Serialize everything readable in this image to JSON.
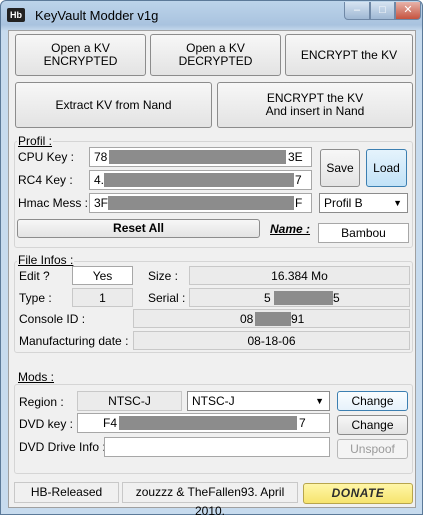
{
  "window": {
    "icon_text": "Hb",
    "title": "KeyVault Modder v1g",
    "min": "–",
    "max": "□",
    "close": "✕"
  },
  "actions": {
    "open_encrypted": "Open a KV\nENCRYPTED",
    "open_decrypted": "Open a KV\nDECRYPTED",
    "encrypt": "ENCRYPT the KV",
    "extract": "Extract KV from Nand",
    "encrypt_insert": "ENCRYPT the KV\nAnd insert in Nand"
  },
  "profil": {
    "legend": "Profil :",
    "cpu_label": "CPU Key :",
    "cpu_start": "78",
    "cpu_end": "3E",
    "rc4_label": "RC4 Key :",
    "rc4_start": "4.",
    "rc4_end": "7",
    "hmac_label": "Hmac Mess :",
    "hmac_start": "3F",
    "hmac_end": "F",
    "save": "Save",
    "load": "Load",
    "profile_select": "Profil B",
    "reset_all": "Reset All",
    "name_label": "Name :",
    "name_value": "Bambou"
  },
  "fileinfo": {
    "legend": "File Infos :",
    "edit_label": "Edit ?",
    "edit_value": "Yes",
    "size_label": "Size :",
    "size_value": "16.384 Mo",
    "type_label": "Type :",
    "type_value": "1",
    "serial_label": "Serial :",
    "serial_start": "5",
    "serial_end": "5",
    "console_label": "Console ID :",
    "console_start": "08",
    "console_end": "91",
    "mfg_label": "Manufacturing date :",
    "mfg_value": "08-18-06"
  },
  "mods": {
    "legend": "Mods :",
    "region_label": "Region :",
    "region_value": "NTSC-J",
    "region_select": "NTSC-J",
    "change1": "Change",
    "dvd_label": "DVD key :",
    "dvd_start": "F4",
    "dvd_end": "7",
    "change2": "Change",
    "drive_label": "DVD Drive Info :",
    "drive_value": "",
    "unspoof": "Unspoof"
  },
  "status": {
    "released": "HB-Released",
    "credits": "zouzzz & TheFallen93. April 2010.",
    "donate": "DONATE"
  }
}
